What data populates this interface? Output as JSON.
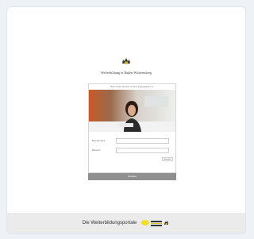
{
  "portal": {
    "logo_text": "Weiterbildung in Baden-Württemberg",
    "form_title": "Bitte melden Sie sich mit Ihren Zugangsdaten an",
    "username_label": "Benutzername",
    "password_label": "Passwort",
    "small_button_label": "Anmelden",
    "submit_label": "Anmelden"
  },
  "footer": {
    "text": "Die Weiterbildungsportale"
  },
  "colors": {
    "submit_bar": "#8f8f8f",
    "footer_bg": "#ebebeb",
    "footer_logo_yellow": "#f2dc2a"
  }
}
